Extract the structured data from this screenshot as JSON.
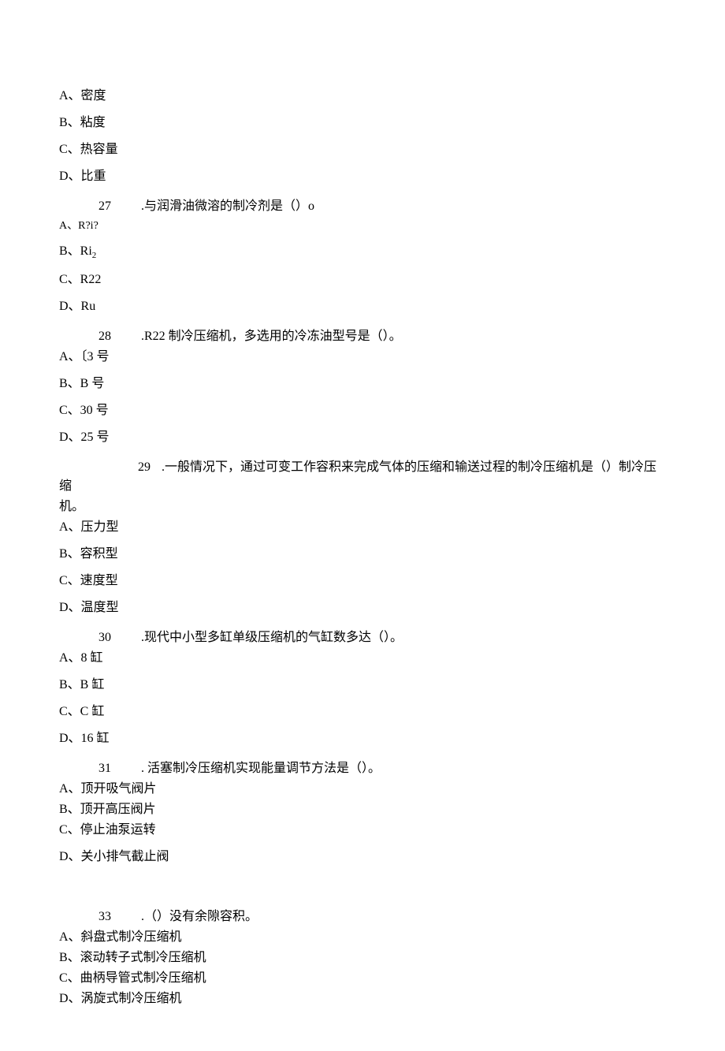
{
  "q_prev": {
    "options": {
      "a": "A、密度",
      "b": "B、粘度",
      "c": "C、热容量",
      "d": "D、比重"
    }
  },
  "q27": {
    "num": "27",
    "stem": ".与润滑油微溶的制冷剂是（）o",
    "options": {
      "a_prefix": "A、",
      "a_text": "R?i?",
      "b_prefix": "B、Ri",
      "b_sub": "2",
      "c": "C、R22",
      "d": "D、Ru"
    }
  },
  "q28": {
    "num": "28",
    "stem": ".R22 制冷压缩机，多选用的冷冻油型号是（）。",
    "options": {
      "a": "A、〔3 号",
      "b": "B、B 号",
      "c": "C、30 号",
      "d": "D、25 号"
    }
  },
  "q29": {
    "num": "29",
    "stem": ".一般情况下，通过可变工作容积来完成气体的压缩和输送过程的制冷压缩机是（）制冷压缩",
    "stem_cont": "机。",
    "options": {
      "a": "A、压力型",
      "b": "B、容积型",
      "c": "C、速度型",
      "d": "D、温度型"
    }
  },
  "q30": {
    "num": "30",
    "stem": ".现代中小型多缸单级压缩机的气缸数多达（）。",
    "options": {
      "a": "A、8 缸",
      "b": "B、B 缸",
      "c": "C、C 缸",
      "d": "D、16 缸"
    }
  },
  "q31": {
    "num": "31",
    "stem": ". 活塞制冷压缩机实现能量调节方法是（）。",
    "options": {
      "a": "A、顶开吸气阀片",
      "b": "B、顶开高压阀片",
      "c": "C、停止油泵运转",
      "d": "D、关小排气截止阀"
    }
  },
  "q33": {
    "num": "33",
    "stem": ".（）没有余隙容积。",
    "options": {
      "a": "A、斜盘式制冷压缩机",
      "b": "B、滚动转子式制冷压缩机",
      "c": "C、曲柄导管式制冷压缩机",
      "d": "D、涡旋式制冷压缩机"
    }
  }
}
